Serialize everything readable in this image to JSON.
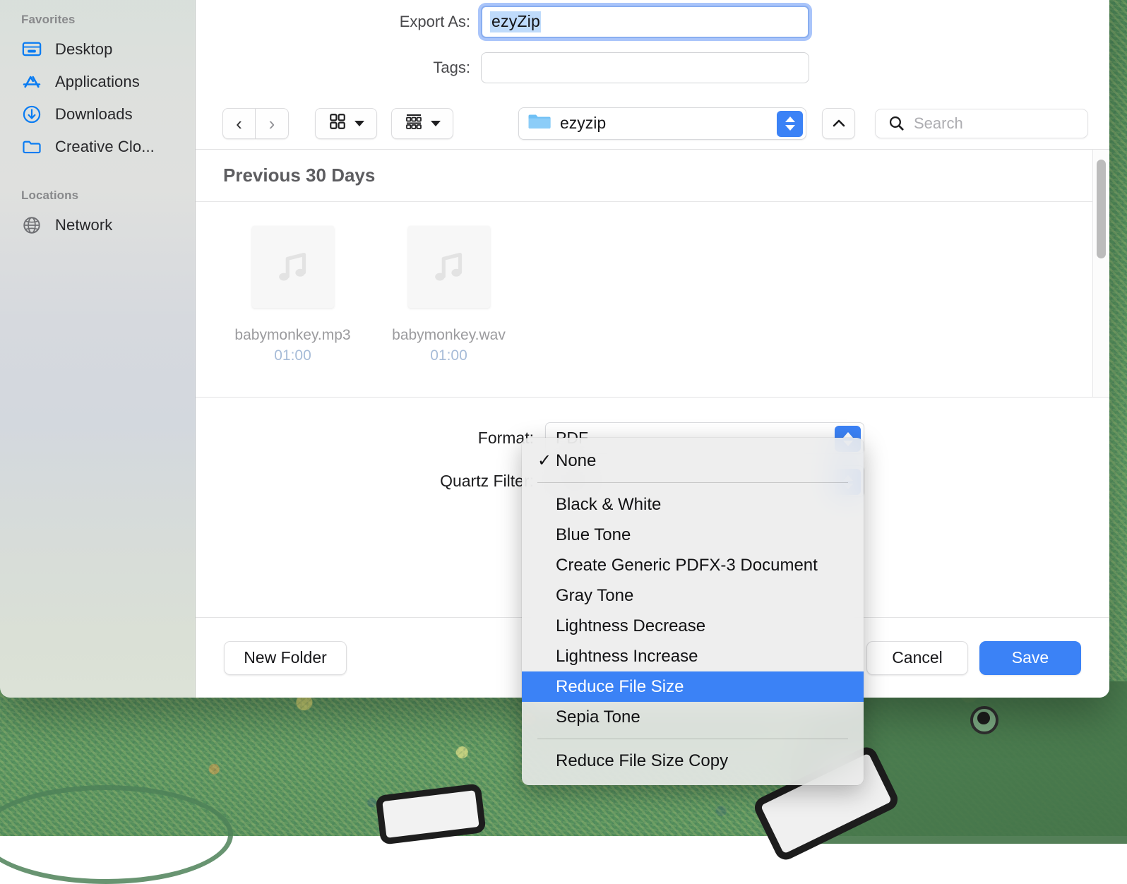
{
  "sidebar": {
    "sections": [
      {
        "title": "Favorites",
        "items": [
          {
            "label": "Desktop",
            "icon": "desktop-icon"
          },
          {
            "label": "Applications",
            "icon": "applications-icon"
          },
          {
            "label": "Downloads",
            "icon": "downloads-icon"
          },
          {
            "label": "Creative Clo...",
            "icon": "folder-icon"
          }
        ]
      },
      {
        "title": "Locations",
        "items": [
          {
            "label": "Network",
            "icon": "network-globe-icon"
          }
        ]
      }
    ]
  },
  "form": {
    "export_as_label": "Export As:",
    "export_as_value": "ezyZip",
    "tags_label": "Tags:",
    "tags_value": "",
    "tags_placeholder": ""
  },
  "toolbar": {
    "back_glyph": "‹",
    "forward_glyph": "›",
    "icon_view_label": "icon-view",
    "group_view_label": "group-view",
    "path_label": "ezyzip",
    "share_glyph": "⌃",
    "search_placeholder": "Search"
  },
  "browser": {
    "group_title": "Previous 30 Days",
    "files": [
      {
        "name": "babymonkey.mp3",
        "duration": "01:00",
        "kind": "audio"
      },
      {
        "name": "babymonkey.wav",
        "duration": "01:00",
        "kind": "audio"
      }
    ]
  },
  "options": {
    "format_label": "Format:",
    "format_value": "PDF",
    "quartz_label": "Quartz Filter:",
    "quartz_value": "None"
  },
  "footer": {
    "new_folder_label": "New Folder",
    "cancel_label": "Cancel",
    "save_label": "Save"
  },
  "menu": {
    "items": [
      {
        "label": "None",
        "checked": true,
        "selected": false
      },
      {
        "separator": true
      },
      {
        "label": "Black & White",
        "checked": false,
        "selected": false
      },
      {
        "label": "Blue Tone",
        "checked": false,
        "selected": false
      },
      {
        "label": "Create Generic PDFX-3 Document",
        "checked": false,
        "selected": false
      },
      {
        "label": "Gray Tone",
        "checked": false,
        "selected": false
      },
      {
        "label": "Lightness Decrease",
        "checked": false,
        "selected": false
      },
      {
        "label": "Lightness Increase",
        "checked": false,
        "selected": false
      },
      {
        "label": "Reduce File Size",
        "checked": false,
        "selected": true
      },
      {
        "label": "Sepia Tone",
        "checked": false,
        "selected": false
      },
      {
        "separator": true
      },
      {
        "label": "Reduce File Size Copy",
        "checked": false,
        "selected": false
      }
    ],
    "check_glyph": "✓"
  },
  "colors": {
    "accent": "#3b82f6",
    "selection": "#bfdbfb",
    "sidebar_icon": "#0a7cf2",
    "desktop_green": "#5a9460"
  }
}
